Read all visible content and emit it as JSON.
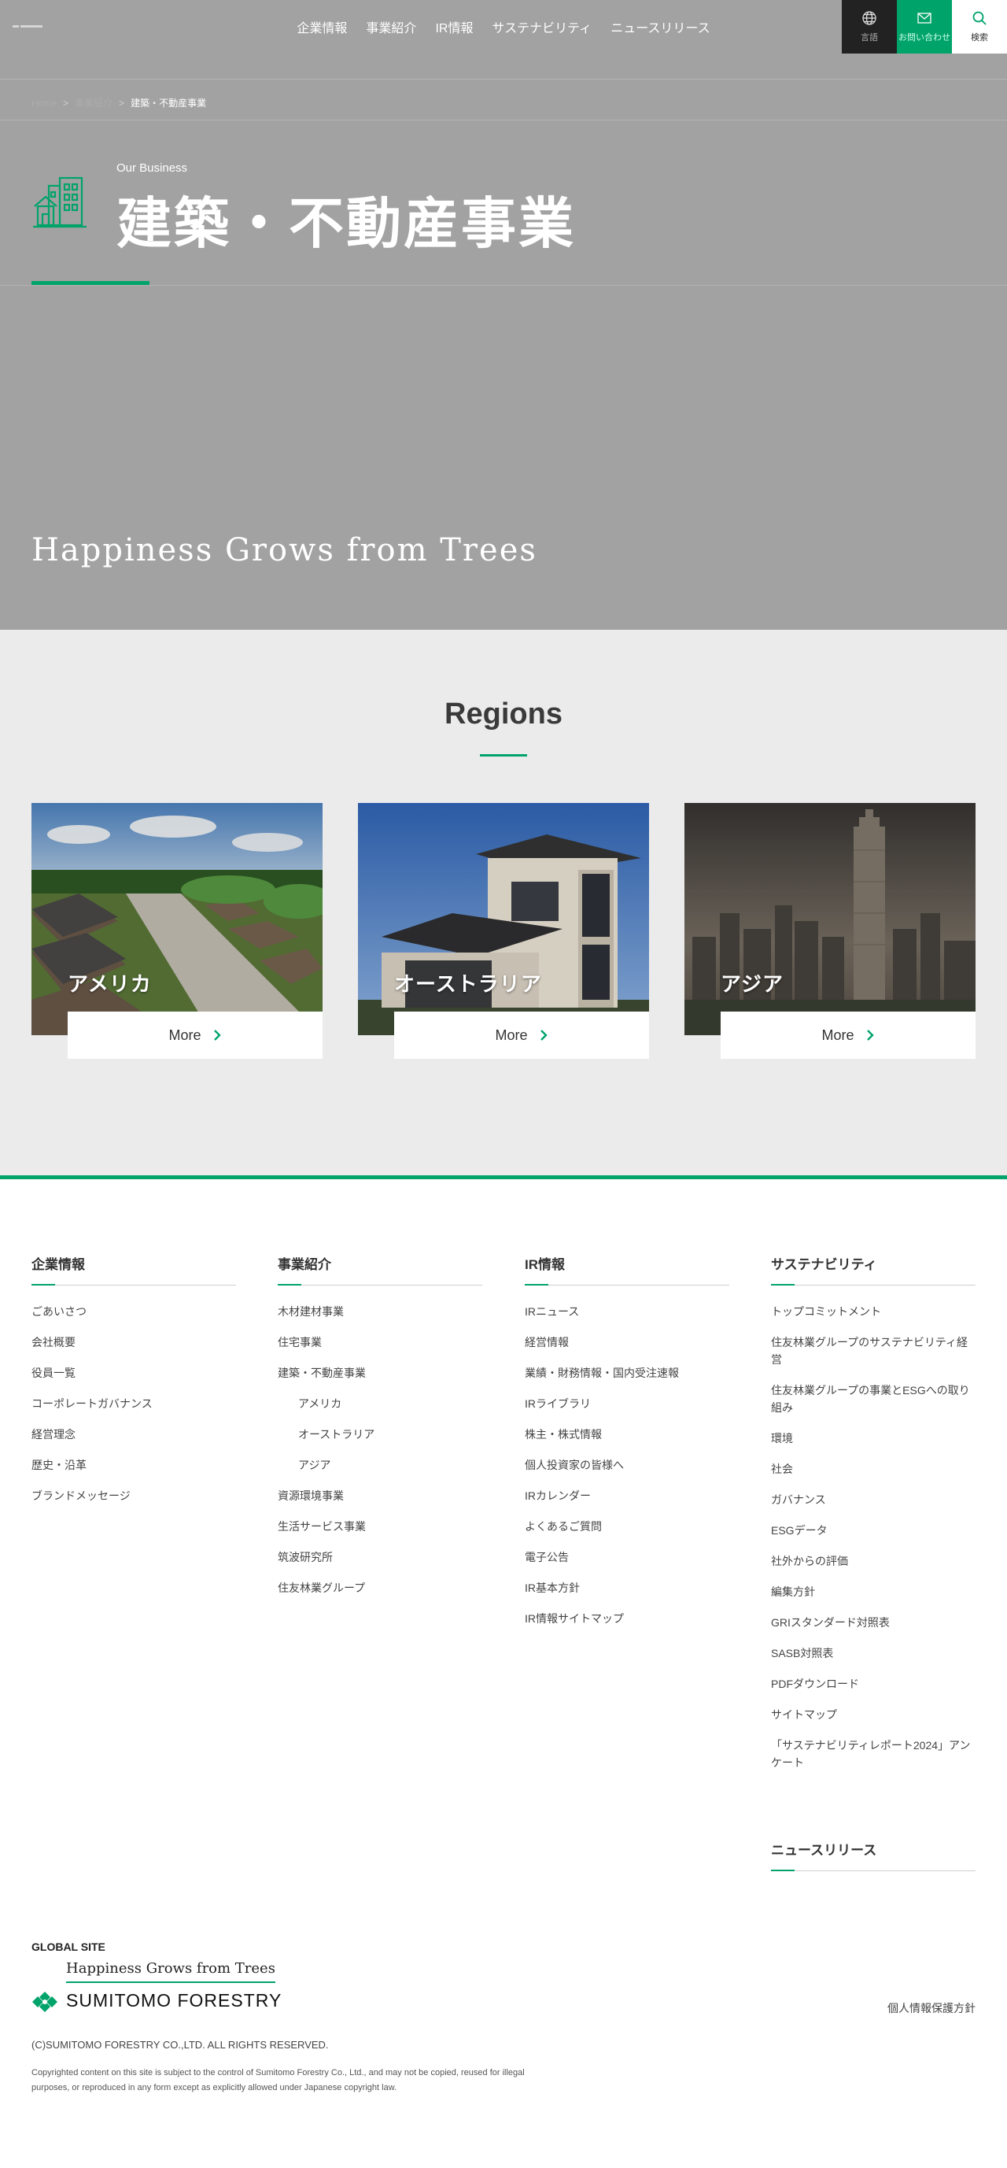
{
  "header": {
    "nav": [
      "企業情報",
      "事業紹介",
      "IR情報",
      "サステナビリティ",
      "ニュースリリース"
    ],
    "util": {
      "lang": "言語",
      "contact": "お問い合わせ",
      "search": "検索"
    }
  },
  "breadcrumb": {
    "items": [
      "Home",
      "事業紹介"
    ],
    "current": "建築・不動産事業",
    "separator": ">"
  },
  "hero": {
    "eyebrow": "Our Business",
    "title": "建築・不動産事業",
    "tagline": "Happiness Grows from Trees"
  },
  "regions": {
    "title": "Regions",
    "more_label": "More",
    "cards": [
      {
        "label": "アメリカ",
        "image": "suburban-neighborhood-aerial"
      },
      {
        "label": "オーストラリア",
        "image": "modern-two-story-house"
      },
      {
        "label": "アジア",
        "image": "city-skyline-tower"
      }
    ]
  },
  "footer": {
    "columns": [
      {
        "title": "企業情報",
        "items": [
          {
            "label": "ごあいさつ"
          },
          {
            "label": "会社概要"
          },
          {
            "label": "役員一覧"
          },
          {
            "label": "コーポレートガバナンス"
          },
          {
            "label": "経営理念"
          },
          {
            "label": "歴史・沿革"
          },
          {
            "label": "ブランドメッセージ"
          }
        ]
      },
      {
        "title": "事業紹介",
        "items": [
          {
            "label": "木材建材事業"
          },
          {
            "label": "住宅事業"
          },
          {
            "label": "建築・不動産事業"
          },
          {
            "label": "アメリカ",
            "sub": true
          },
          {
            "label": "オーストラリア",
            "sub": true
          },
          {
            "label": "アジア",
            "sub": true
          },
          {
            "label": "資源環境事業"
          },
          {
            "label": "生活サービス事業"
          },
          {
            "label": "筑波研究所"
          },
          {
            "label": "住友林業グループ"
          }
        ]
      },
      {
        "title": "IR情報",
        "items": [
          {
            "label": "IRニュース"
          },
          {
            "label": "経営情報"
          },
          {
            "label": "業績・財務情報・国内受注速報"
          },
          {
            "label": "IRライブラリ"
          },
          {
            "label": "株主・株式情報"
          },
          {
            "label": "個人投資家の皆様へ"
          },
          {
            "label": "IRカレンダー"
          },
          {
            "label": "よくあるご質問"
          },
          {
            "label": "電子公告"
          },
          {
            "label": "IR基本方針"
          },
          {
            "label": "IR情報サイトマップ"
          }
        ]
      },
      {
        "title": "サステナビリティ",
        "items": [
          {
            "label": "トップコミットメント"
          },
          {
            "label": "住友林業グループのサステナビリティ経営"
          },
          {
            "label": "住友林業グループの事業とESGへの取り組み"
          },
          {
            "label": "環境"
          },
          {
            "label": "社会"
          },
          {
            "label": "ガバナンス"
          },
          {
            "label": "ESGデータ"
          },
          {
            "label": "社外からの評価"
          },
          {
            "label": "編集方針"
          },
          {
            "label": "GRIスタンダード対照表"
          },
          {
            "label": "SASB対照表"
          },
          {
            "label": "PDFダウンロード"
          },
          {
            "label": "サイトマップ"
          },
          {
            "label": "「サステナビリティレポート2024」アンケート"
          }
        ]
      }
    ],
    "news_title": "ニュースリリース",
    "global_site": "GLOBAL SITE",
    "brand_tagline": "Happiness Grows from Trees",
    "brand_name": "SUMITOMO FORESTRY",
    "privacy": "個人情報保護方針",
    "copyright": "(C)SUMITOMO FORESTRY CO.,LTD. ALL RIGHTS RESERVED.",
    "notice": "Copyrighted content on this site is subject to the control of Sumitomo Forestry Co., Ltd., and may not be copied, reused for illegal purposes, or reproduced in any form except as explicitly allowed under Japanese copyright law."
  },
  "colors": {
    "accent": "#00a36a",
    "hero_bg": "#a2a2a2",
    "regions_bg": "#ebebeb"
  }
}
